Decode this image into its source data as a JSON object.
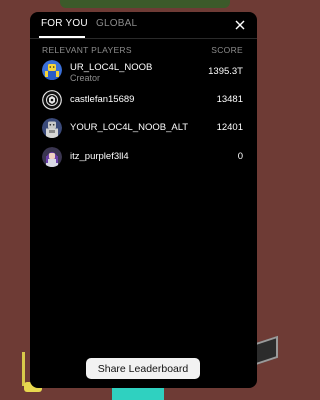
{
  "tabs": [
    {
      "label": "FOR YOU",
      "active": true
    },
    {
      "label": "GLOBAL",
      "active": false
    }
  ],
  "columns": {
    "players": "RELEVANT PLAYERS",
    "score": "SCORE"
  },
  "players": [
    {
      "name": "UR_LOC4L_NOOB",
      "subtitle": "Creator",
      "score": "1395.3T",
      "avatar": "yellow-noob-avatar"
    },
    {
      "name": "castlefan15689",
      "subtitle": "",
      "score": "13481",
      "avatar": "white-emblem-avatar"
    },
    {
      "name": "YOUR_LOC4L_NOOB_ALT",
      "subtitle": "",
      "score": "12401",
      "avatar": "gray-character-avatar"
    },
    {
      "name": "itz_purplef3ll4",
      "subtitle": "",
      "score": "0",
      "avatar": "purple-character-avatar"
    }
  ],
  "share_button": "Share Leaderboard",
  "colors": {
    "panel_bg": "#000000",
    "page_bg": "#6e3b35",
    "muted_text": "#8d8d8d",
    "button_bg": "#f2f2f2"
  }
}
